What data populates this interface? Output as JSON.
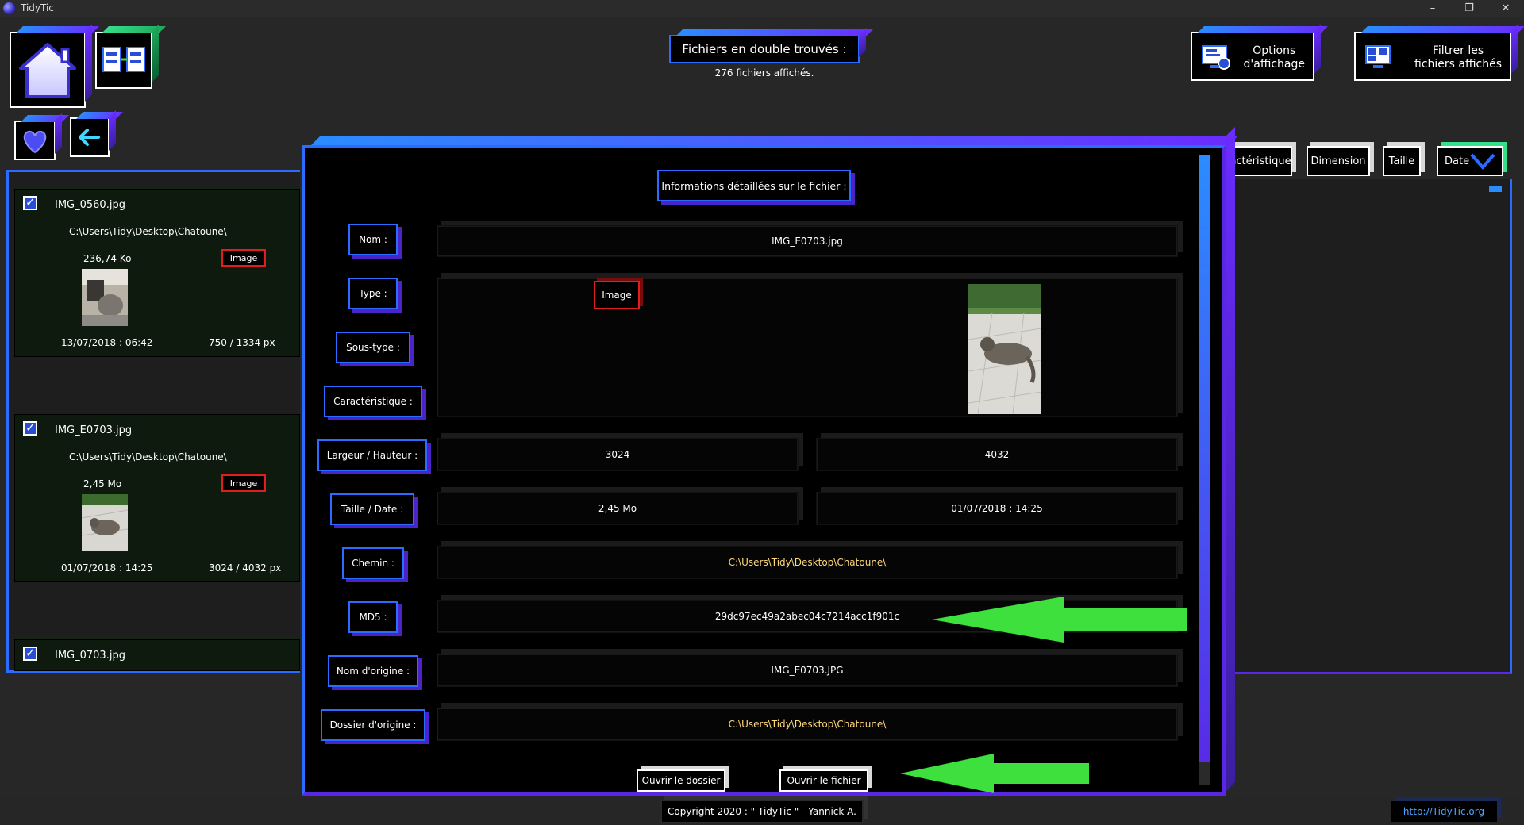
{
  "window": {
    "title": "TidyTic",
    "minimize": "–",
    "restore": "❐",
    "close": "✕"
  },
  "header": {
    "title": "Fichiers en double trouvés :",
    "subtitle": "276 fichiers affichés."
  },
  "toolbar": {
    "options_label": "Options\nd'affichage",
    "filter_label": "Filtrer les\nfichiers affichés"
  },
  "sort_tabs": [
    "actéristique",
    "Dimension",
    "Taille",
    "Date"
  ],
  "cards": [
    {
      "name": "IMG_0560.jpg",
      "path": "C:\\Users\\Tidy\\Desktop\\Chatoune\\",
      "size": "236,74 Ko",
      "type": "Image",
      "date": "13/07/2018 : 06:42",
      "dim": "750 / 1334 px"
    },
    {
      "name": "IMG_E0703.jpg",
      "path": "C:\\Users\\Tidy\\Desktop\\Chatoune\\",
      "size": "2,45 Mo",
      "type": "Image",
      "date": "01/07/2018 : 14:25",
      "dim": "3024 / 4032 px"
    },
    {
      "name": "IMG_0703.jpg"
    }
  ],
  "modal": {
    "title": "Informations détaillées sur le fichier :",
    "labels": {
      "nom": "Nom :",
      "type": "Type :",
      "soustype": "Sous-type :",
      "caract": "Caractéristique :",
      "largeur": "Largeur / Hauteur :",
      "taille": "Taille / Date :",
      "chemin": "Chemin :",
      "md5": "MD5 :",
      "nomorigine": "Nom d'origine :",
      "dossierorigine": "Dossier d'origine :"
    },
    "values": {
      "nom": "IMG_E0703.jpg",
      "type": "Image",
      "largeur": "3024",
      "hauteur": "4032",
      "taille": "2,45 Mo",
      "date": "01/07/2018 : 14:25",
      "chemin": "C:\\Users\\Tidy\\Desktop\\Chatoune\\",
      "md5": "29dc97ec49a2abec04c7214acc1f901c",
      "nomorigine": "IMG_E0703.JPG",
      "dossierorigine": "C:\\Users\\Tidy\\Desktop\\Chatoune\\"
    },
    "buttons": {
      "open_folder": "Ouvrir le dossier",
      "open_file": "Ouvrir le fichier"
    }
  },
  "footer": {
    "copyright": "Copyright 2020 : \" TidyTic \" - Yannick A.",
    "link": "http://TidyTic.org"
  },
  "colors": {
    "accent_blue": "#2a6cff",
    "accent_purple": "#5a27e6",
    "path_yellow": "#ffd87a",
    "arrow_green": "#3ee03e",
    "type_red": "#e21d1d"
  }
}
